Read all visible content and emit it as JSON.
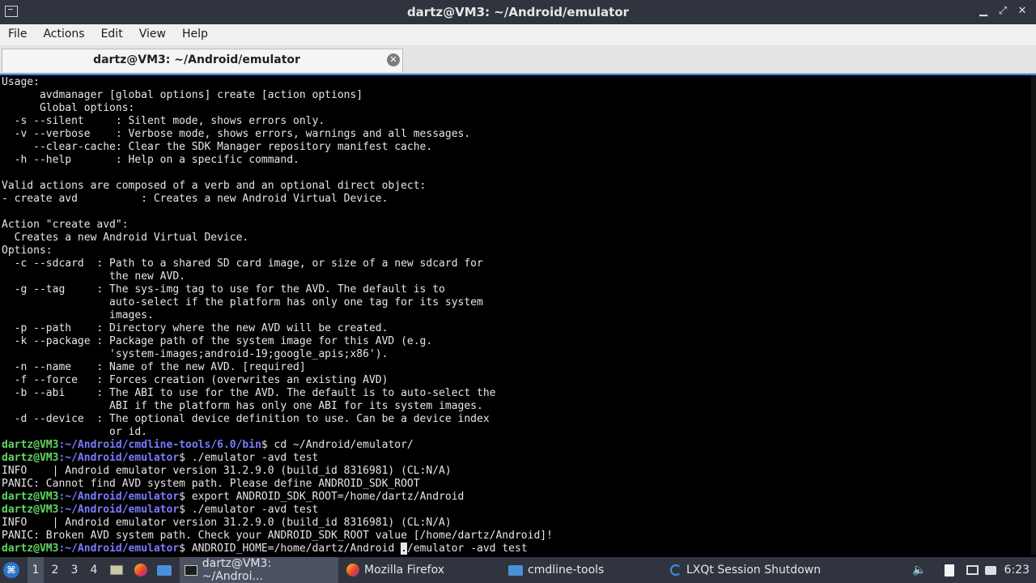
{
  "window": {
    "title": "dartz@VM3: ~/Android/emulator",
    "minimize_glyph": "▁",
    "restore_glyph": "⤢",
    "close_glyph": "✕"
  },
  "menu": [
    "File",
    "Actions",
    "Edit",
    "View",
    "Help"
  ],
  "tab": {
    "label": "dartz@VM3: ~/Android/emulator",
    "close_glyph": "✕"
  },
  "terminal": {
    "lines": [
      {
        "text": "Usage:"
      },
      {
        "text": "      avdmanager [global options] create [action options]"
      },
      {
        "text": "      Global options:"
      },
      {
        "text": "  -s --silent     : Silent mode, shows errors only."
      },
      {
        "text": "  -v --verbose    : Verbose mode, shows errors, warnings and all messages."
      },
      {
        "text": "     --clear-cache: Clear the SDK Manager repository manifest cache."
      },
      {
        "text": "  -h --help       : Help on a specific command."
      },
      {
        "text": ""
      },
      {
        "text": "Valid actions are composed of a verb and an optional direct object:"
      },
      {
        "text": "- create avd          : Creates a new Android Virtual Device."
      },
      {
        "text": ""
      },
      {
        "text": "Action \"create avd\":"
      },
      {
        "text": "  Creates a new Android Virtual Device."
      },
      {
        "text": "Options:"
      },
      {
        "text": "  -c --sdcard  : Path to a shared SD card image, or size of a new sdcard for"
      },
      {
        "text": "                 the new AVD."
      },
      {
        "text": "  -g --tag     : The sys-img tag to use for the AVD. The default is to"
      },
      {
        "text": "                 auto-select if the platform has only one tag for its system"
      },
      {
        "text": "                 images."
      },
      {
        "text": "  -p --path    : Directory where the new AVD will be created."
      },
      {
        "text": "  -k --package : Package path of the system image for this AVD (e.g."
      },
      {
        "text": "                 'system-images;android-19;google_apis;x86')."
      },
      {
        "text": "  -n --name    : Name of the new AVD. [required]"
      },
      {
        "text": "  -f --force   : Forces creation (overwrites an existing AVD)"
      },
      {
        "text": "  -b --abi     : The ABI to use for the AVD. The default is to auto-select the"
      },
      {
        "text": "                 ABI if the platform has only one ABI for its system images."
      },
      {
        "text": "  -d --device  : The optional device definition to use. Can be a device index"
      },
      {
        "text": "                 or id."
      },
      {
        "user": "dartz@VM3",
        "path": ":~/Android/cmdline-tools/6.0/bin",
        "cmd": "$ cd ~/Android/emulator/"
      },
      {
        "user": "dartz@VM3",
        "path": ":~/Android/emulator",
        "cmd": "$ ./emulator -avd test"
      },
      {
        "text": "INFO    | Android emulator version 31.2.9.0 (build_id 8316981) (CL:N/A)"
      },
      {
        "text": "PANIC: Cannot find AVD system path. Please define ANDROID_SDK_ROOT"
      },
      {
        "user": "dartz@VM3",
        "path": ":~/Android/emulator",
        "cmd": "$ export ANDROID_SDK_ROOT=/home/dartz/Android"
      },
      {
        "user": "dartz@VM3",
        "path": ":~/Android/emulator",
        "cmd": "$ ./emulator -avd test"
      },
      {
        "text": "INFO    | Android emulator version 31.2.9.0 (build_id 8316981) (CL:N/A)"
      },
      {
        "text": "PANIC: Broken AVD system path. Check your ANDROID_SDK_ROOT value [/home/dartz/Android]!"
      },
      {
        "user": "dartz@VM3",
        "path": ":~/Android/emulator",
        "cmd": "$ ANDROID_HOME=/home/dartz/Android ",
        "cursor": ".",
        "after": "/emulator -avd test"
      }
    ]
  },
  "taskbar": {
    "desktops": [
      "1",
      "2",
      "3",
      "4"
    ],
    "tasks": [
      {
        "label": "dartz@VM3: ~/Androi...",
        "icon": "terminal-icon",
        "active": true
      },
      {
        "label": "Mozilla Firefox",
        "icon": "firefox-icon",
        "active": false
      },
      {
        "label": "cmdline-tools",
        "icon": "folder-icon",
        "active": false
      },
      {
        "label": "LXQt Session Shutdown",
        "icon": "lxqt-icon",
        "active": false
      }
    ],
    "clock": "6:23"
  }
}
